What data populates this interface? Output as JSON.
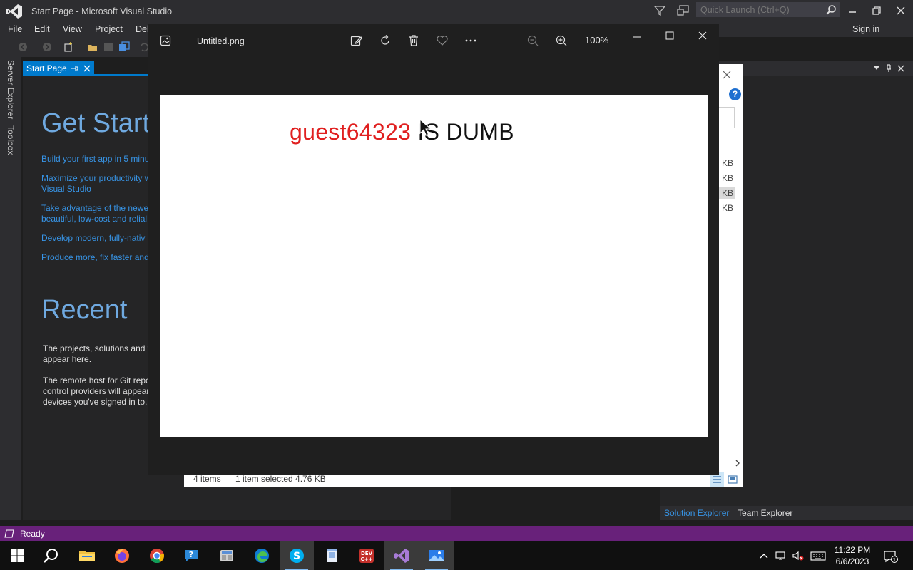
{
  "colors": {
    "vs_accent": "#007acc",
    "status_bar": "#68217a",
    "link_blue": "#3794e6",
    "name_red": "#e02020"
  },
  "vs": {
    "title": "Start Page - Microsoft Visual Studio",
    "quick_launch_placeholder": "Quick Launch (Ctrl+Q)",
    "menu": [
      "File",
      "Edit",
      "View",
      "Project",
      "Del"
    ],
    "sign_in": "Sign in",
    "side_tabs": [
      "Server Explorer",
      "Toolbox"
    ],
    "doc_tab": "Start Page",
    "start_page": {
      "heading": "Get Starte",
      "links": [
        "Build your first app in 5 minu",
        "Maximize your productivity w\nVisual Studio",
        "Take advantage of the newes\nbeautiful, low-cost and relial",
        "Develop modern, fully-nativ",
        "Produce more, fix faster and"
      ],
      "recent_heading": "Recent",
      "recent_text_1": "The projects, solutions and f\nappear here.",
      "recent_text_2": "The remote host for Git repo\ncontrol providers will appear\ndevices you've signed in to."
    },
    "bottom_tabs": {
      "solution_explorer": "Solution Explorer",
      "team_explorer": "Team Explorer"
    },
    "status": "Ready"
  },
  "explorer": {
    "size_units": [
      "KB",
      "KB",
      "KB",
      "KB"
    ],
    "help": "?",
    "status_items": "4 items",
    "status_selected": "1 item selected  4.76 KB"
  },
  "photos": {
    "filename": "Untitled.png",
    "zoom": "100%",
    "image_text_name": "guest64323",
    "image_text_rest": " IS DUMB",
    "icons": [
      "edit-image-icon",
      "rotate-icon",
      "delete-icon",
      "favorite-icon",
      "more-icon",
      "zoom-out-icon",
      "zoom-in-icon"
    ]
  },
  "taskbar": {
    "apps": [
      "start-icon",
      "search-icon",
      "file-explorer-icon",
      "firefox-icon",
      "chrome-icon",
      "help-icon",
      "app-icon",
      "edge-icon",
      "skype-icon",
      "notepad-icon",
      "devcpp-icon",
      "visual-studio-icon",
      "photos-icon"
    ],
    "devcpp_label": "DEV C++",
    "skype_label": "S",
    "time": "11:22 PM",
    "date": "6/6/2023",
    "notifications": "1"
  }
}
